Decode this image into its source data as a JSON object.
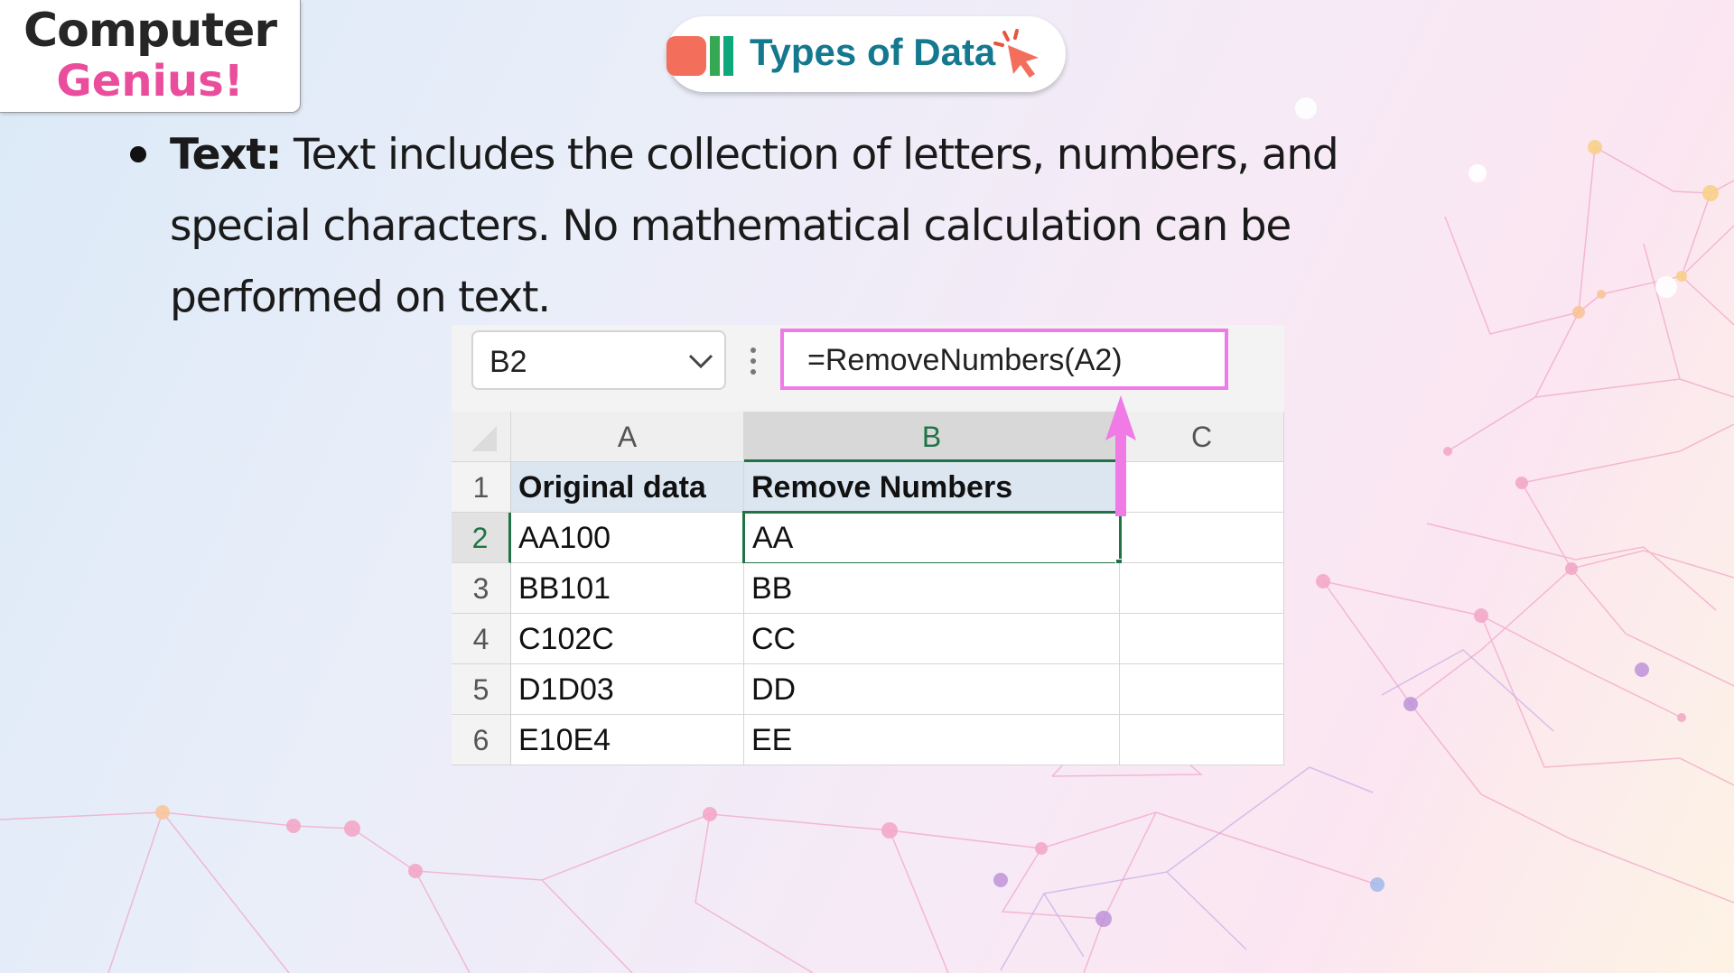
{
  "logo": {
    "line1": "Computer",
    "line2": "Genius!"
  },
  "title": {
    "text": "Types of Data"
  },
  "bullet": {
    "term": "Text:",
    "description": " Text includes the collection of letters, numbers, and special characters. No mathematical calculation can be performed on text."
  },
  "excel": {
    "name_box": "B2",
    "formula": "=RemoveNumbers(A2)",
    "columns": [
      "A",
      "B",
      "C"
    ],
    "rows": [
      {
        "num": "1",
        "a": "Original data",
        "b": "Remove Numbers",
        "c": ""
      },
      {
        "num": "2",
        "a": "AA100",
        "b": "AA",
        "c": ""
      },
      {
        "num": "3",
        "a": "BB101",
        "b": "BB",
        "c": ""
      },
      {
        "num": "4",
        "a": "C102C",
        "b": "CC",
        "c": ""
      },
      {
        "num": "5",
        "a": "D1D03",
        "b": "DD",
        "c": ""
      },
      {
        "num": "6",
        "a": "E10E4",
        "b": "EE",
        "c": ""
      }
    ]
  },
  "colors": {
    "logo_pink": "#ea4d9c",
    "title_teal": "#14788f",
    "excel_green": "#217346",
    "highlight_magenta": "#f07ae6"
  }
}
